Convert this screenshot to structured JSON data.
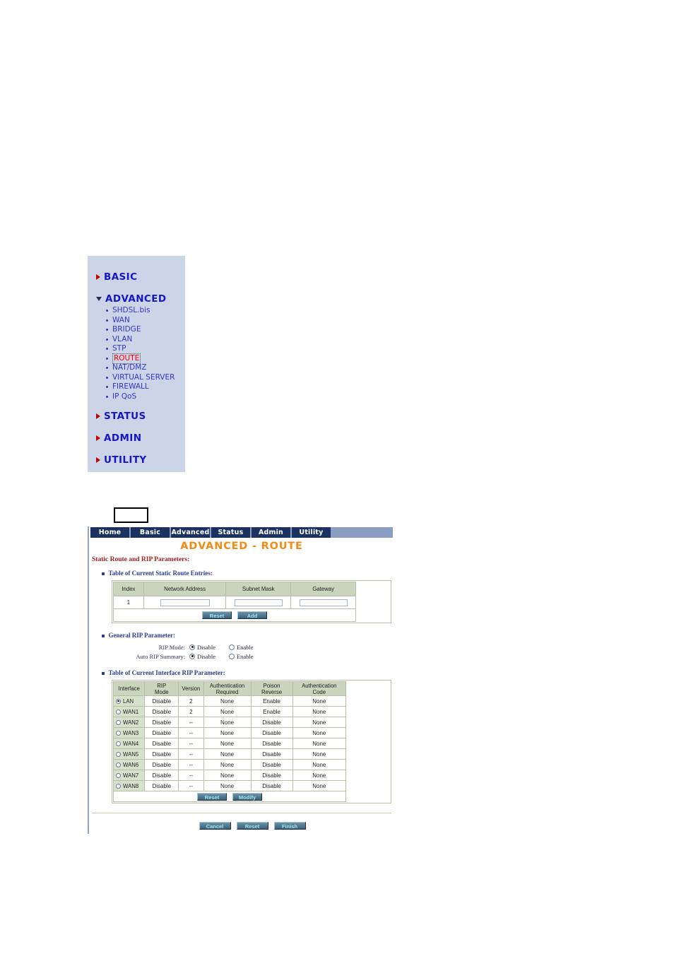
{
  "sidebar": {
    "sections": [
      {
        "label": "BASIC",
        "state": "collapsed",
        "arrow": "triangle-right-icon",
        "items": []
      },
      {
        "label": "ADVANCED",
        "state": "expanded",
        "arrow": "triangle-down-icon",
        "items": [
          {
            "label": "SHDSL.bis",
            "current": false
          },
          {
            "label": "WAN",
            "current": false
          },
          {
            "label": "BRIDGE",
            "current": false
          },
          {
            "label": "VLAN",
            "current": false
          },
          {
            "label": "STP",
            "current": false
          },
          {
            "label": "ROUTE",
            "current": true
          },
          {
            "label": "NAT/DMZ",
            "current": false
          },
          {
            "label": "VIRTUAL SERVER",
            "current": false
          },
          {
            "label": "FIREWALL",
            "current": false
          },
          {
            "label": "IP QoS",
            "current": false
          }
        ]
      },
      {
        "label": "STATUS",
        "state": "collapsed",
        "arrow": "triangle-right-icon",
        "items": []
      },
      {
        "label": "ADMIN",
        "state": "collapsed",
        "arrow": "triangle-right-icon",
        "items": []
      },
      {
        "label": "UTILITY",
        "state": "collapsed",
        "arrow": "triangle-right-icon",
        "items": []
      }
    ],
    "colors": {
      "background": "#ccd5e8",
      "link": "#3333cc",
      "heading": "#1616c8",
      "current": "#ff0000"
    }
  },
  "navbar": {
    "tabs": [
      {
        "label": "Home"
      },
      {
        "label": "Basic"
      },
      {
        "label": "Advanced"
      },
      {
        "label": "Status"
      },
      {
        "label": "Admin"
      },
      {
        "label": "Utility"
      }
    ],
    "colors": {
      "tab_background": "#1b3160",
      "bar_background": "#8b9dc0",
      "tab_text": "#ffffff"
    }
  },
  "page": {
    "title": "ADVANCED - ROUTE",
    "title_color": "#f58a12",
    "section_title": "Static Route and RIP Parameters:"
  },
  "static_route": {
    "heading": "Table of Current Static Route Entries:",
    "columns": [
      "Index",
      "Network Address",
      "Subnet Mask",
      "Gateway"
    ],
    "rows": [
      {
        "index": "1",
        "network_address": "",
        "subnet_mask": "",
        "gateway": ""
      }
    ],
    "inputs": {
      "network_address_placeholder": "",
      "subnet_mask_placeholder": "",
      "gateway_placeholder": ""
    },
    "buttons": [
      {
        "label": "Reset"
      },
      {
        "label": "Add"
      }
    ]
  },
  "general_rip": {
    "heading": "General RIP Parameter:",
    "fields": [
      {
        "label": "RIP Mode:",
        "options": [
          {
            "label": "Disable",
            "selected": true
          },
          {
            "label": "Enable",
            "selected": false
          }
        ]
      },
      {
        "label": "Auto RIP Summary:",
        "options": [
          {
            "label": "Disable",
            "selected": true
          },
          {
            "label": "Enable",
            "selected": false
          }
        ]
      }
    ]
  },
  "interface_rip": {
    "heading": "Table of Current Interface RIP Parameter:",
    "columns": [
      "Interface",
      "RIP\nMode",
      "Version",
      "Authentication\nRequired",
      "Poison\nReverse",
      "Authentication\nCode"
    ],
    "column_labels": [
      {
        "line1": "Interface",
        "line2": ""
      },
      {
        "line1": "RIP",
        "line2": "Mode"
      },
      {
        "line1": "Version",
        "line2": ""
      },
      {
        "line1": "Authentication",
        "line2": "Required"
      },
      {
        "line1": "Poison",
        "line2": "Reverse"
      },
      {
        "line1": "Authentication",
        "line2": "Code"
      }
    ],
    "rows": [
      {
        "interface": "LAN",
        "selected": true,
        "rip_mode": "Disable",
        "version": "2",
        "auth_required": "None",
        "poison_reverse": "Enable",
        "auth_code": "None"
      },
      {
        "interface": "WAN1",
        "selected": false,
        "rip_mode": "Disable",
        "version": "2",
        "auth_required": "None",
        "poison_reverse": "Enable",
        "auth_code": "None"
      },
      {
        "interface": "WAN2",
        "selected": false,
        "rip_mode": "Disable",
        "version": "--",
        "auth_required": "None",
        "poison_reverse": "Disable",
        "auth_code": "None"
      },
      {
        "interface": "WAN3",
        "selected": false,
        "rip_mode": "Disable",
        "version": "--",
        "auth_required": "None",
        "poison_reverse": "Disable",
        "auth_code": "None"
      },
      {
        "interface": "WAN4",
        "selected": false,
        "rip_mode": "Disable",
        "version": "--",
        "auth_required": "None",
        "poison_reverse": "Disable",
        "auth_code": "None"
      },
      {
        "interface": "WAN5",
        "selected": false,
        "rip_mode": "Disable",
        "version": "--",
        "auth_required": "None",
        "poison_reverse": "Disable",
        "auth_code": "None"
      },
      {
        "interface": "WAN6",
        "selected": false,
        "rip_mode": "Disable",
        "version": "--",
        "auth_required": "None",
        "poison_reverse": "Disable",
        "auth_code": "None"
      },
      {
        "interface": "WAN7",
        "selected": false,
        "rip_mode": "Disable",
        "version": "--",
        "auth_required": "None",
        "poison_reverse": "Disable",
        "auth_code": "None"
      },
      {
        "interface": "WAN8",
        "selected": false,
        "rip_mode": "Disable",
        "version": "--",
        "auth_required": "None",
        "poison_reverse": "Disable",
        "auth_code": "None"
      }
    ],
    "buttons": [
      {
        "label": "Reset"
      },
      {
        "label": "Modify"
      }
    ]
  },
  "footer_buttons": [
    {
      "label": "Cancel"
    },
    {
      "label": "Reset"
    },
    {
      "label": "Finish"
    }
  ],
  "theme": {
    "table_header_bg": "#c9d6bd",
    "table_border": "#b9bda8",
    "button_text": "#9fe4f2",
    "section_title_color": "#a02020",
    "sub_heading_color": "#2a3c8f"
  }
}
